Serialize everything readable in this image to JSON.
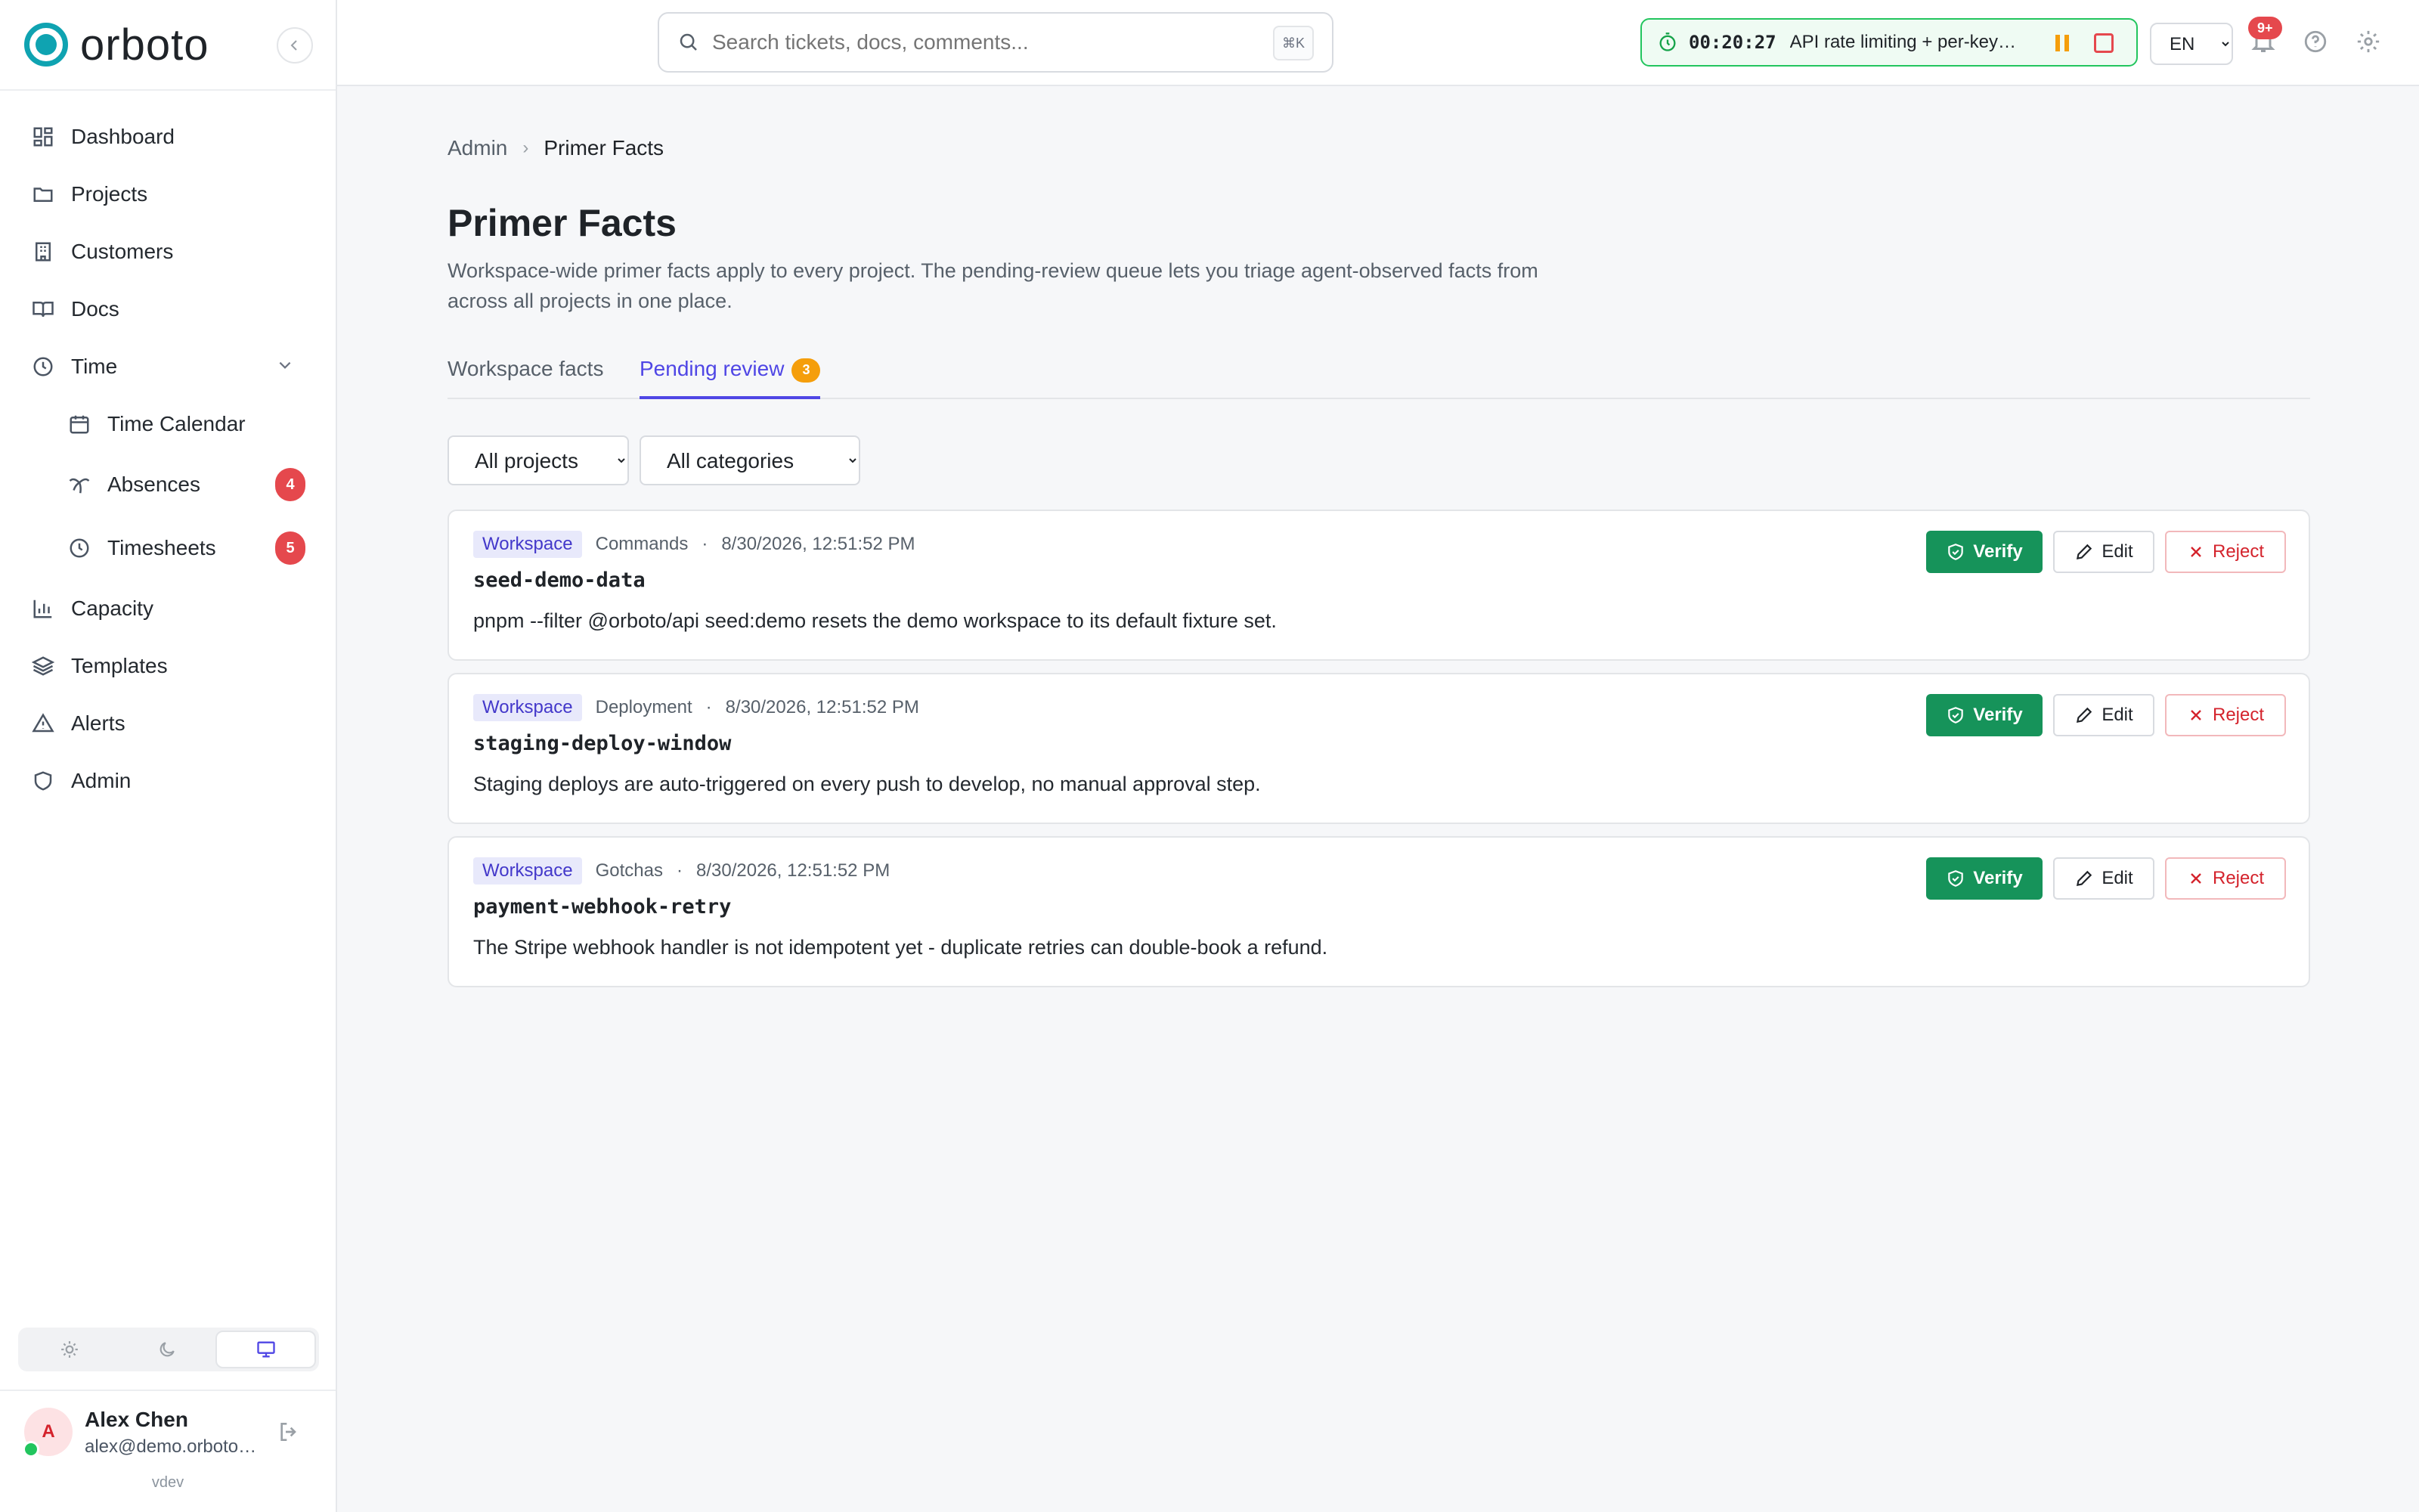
{
  "app": {
    "name": "orboto",
    "version": "vdev"
  },
  "sidebar": {
    "items": [
      {
        "label": "Dashboard"
      },
      {
        "label": "Projects"
      },
      {
        "label": "Customers"
      },
      {
        "label": "Docs"
      },
      {
        "label": "Time"
      },
      {
        "label": "Time Calendar"
      },
      {
        "label": "Absences",
        "badge": "4"
      },
      {
        "label": "Timesheets",
        "badge": "5"
      },
      {
        "label": "Capacity"
      },
      {
        "label": "Templates"
      },
      {
        "label": "Alerts"
      },
      {
        "label": "Admin"
      }
    ],
    "theme_options": [
      "light",
      "dark",
      "system"
    ],
    "theme_selected": "system",
    "user": {
      "initial": "A",
      "name": "Alex Chen",
      "email": "alex@demo.orboto.dev"
    }
  },
  "topbar": {
    "search_placeholder": "Search tickets, docs, comments...",
    "search_shortcut": "⌘K",
    "timer": {
      "time": "00:20:27",
      "label": "API rate limiting + per-key quotas"
    },
    "language": "EN",
    "notifications_badge": "9+"
  },
  "page": {
    "breadcrumb": [
      "Admin",
      "Primer Facts"
    ],
    "title": "Primer Facts",
    "description": "Workspace-wide primer facts apply to every project. The pending-review queue lets you triage agent-observed facts from across all projects in one place.",
    "tabs": [
      {
        "label": "Workspace facts"
      },
      {
        "label": "Pending review",
        "count": "3"
      }
    ],
    "active_tab": "Pending review",
    "filters": {
      "project": "All projects",
      "category": "All categories"
    },
    "actions": {
      "verify": "Verify",
      "edit": "Edit",
      "reject": "Reject"
    }
  },
  "facts": [
    {
      "scope": "Workspace",
      "category": "Commands",
      "date": "8/30/2026, 12:51:52 PM",
      "key": "seed-demo-data",
      "text": "pnpm --filter @orboto/api seed:demo resets the demo workspace to its default fixture set."
    },
    {
      "scope": "Workspace",
      "category": "Deployment",
      "date": "8/30/2026, 12:51:52 PM",
      "key": "staging-deploy-window",
      "text": "Staging deploys are auto-triggered on every push to develop, no manual approval step."
    },
    {
      "scope": "Workspace",
      "category": "Gotchas",
      "date": "8/30/2026, 12:51:52 PM",
      "key": "payment-webhook-retry",
      "text": "The Stripe webhook handler is not idempotent yet - duplicate retries can double-book a refund."
    }
  ],
  "colors": {
    "brand": "#0fa3b1",
    "accent": "#4f46e5",
    "verify": "#16935a",
    "reject": "#d4232c",
    "badge": "#e5484d",
    "timer": "#22c55e"
  }
}
